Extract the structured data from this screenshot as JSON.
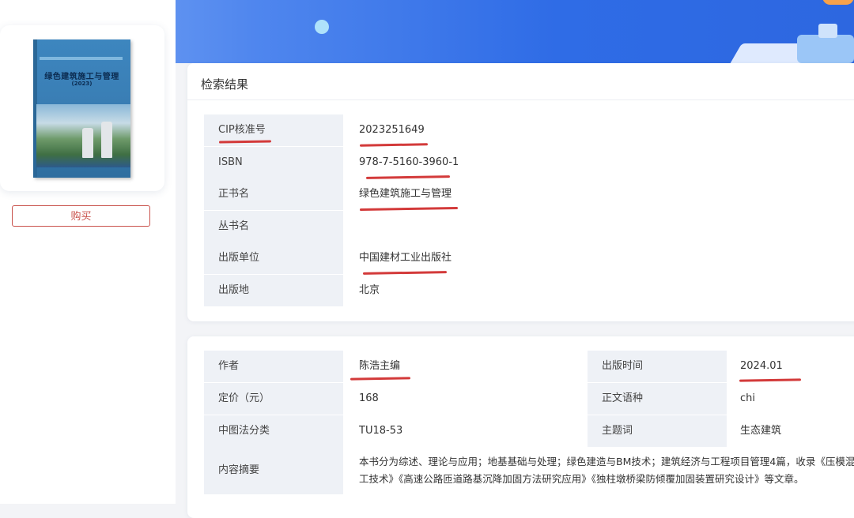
{
  "book": {
    "cover_title": "绿色建筑施工与管理",
    "cover_subtitle": "(2023)"
  },
  "actions": {
    "buy_label": "购买"
  },
  "search_result": {
    "title": "检索结果",
    "rows": [
      {
        "label": "CIP核准号",
        "value": "2023251649"
      },
      {
        "label": "ISBN",
        "value": "978-7-5160-3960-1"
      },
      {
        "label": "正书名",
        "value": "绿色建筑施工与管理"
      },
      {
        "label": "丛书名",
        "value": ""
      },
      {
        "label": "出版单位",
        "value": "中国建材工业出版社"
      },
      {
        "label": "出版地",
        "value": "北京"
      }
    ]
  },
  "details": {
    "left": [
      {
        "label": "作者",
        "value": "陈浩主编"
      },
      {
        "label": "定价（元）",
        "value": "168"
      },
      {
        "label": "中图法分类",
        "value": "TU18-53"
      }
    ],
    "right": [
      {
        "label": "出版时间",
        "value": "2024.01"
      },
      {
        "label": "正文语种",
        "value": "chi"
      },
      {
        "label": "主题词",
        "value": "生态建筑"
      }
    ],
    "abstract_label": "内容摘要",
    "abstract_line1": "本书分为综述、理论与应用；地基基础与处理；绿色建造与BM技术；建筑经济与工程项目管理4篇，收录《压模混凝",
    "abstract_line2": "工技术》《高速公路匝道路基沉降加固方法研究应用》《独柱墩桥梁防倾覆加固装置研究设计》等文章。"
  },
  "colors": {
    "accent_red": "#c9514b",
    "annotation_red": "#d33a3a",
    "banner_blue": "#2f6ce6",
    "label_bg": "#eef1f6"
  }
}
